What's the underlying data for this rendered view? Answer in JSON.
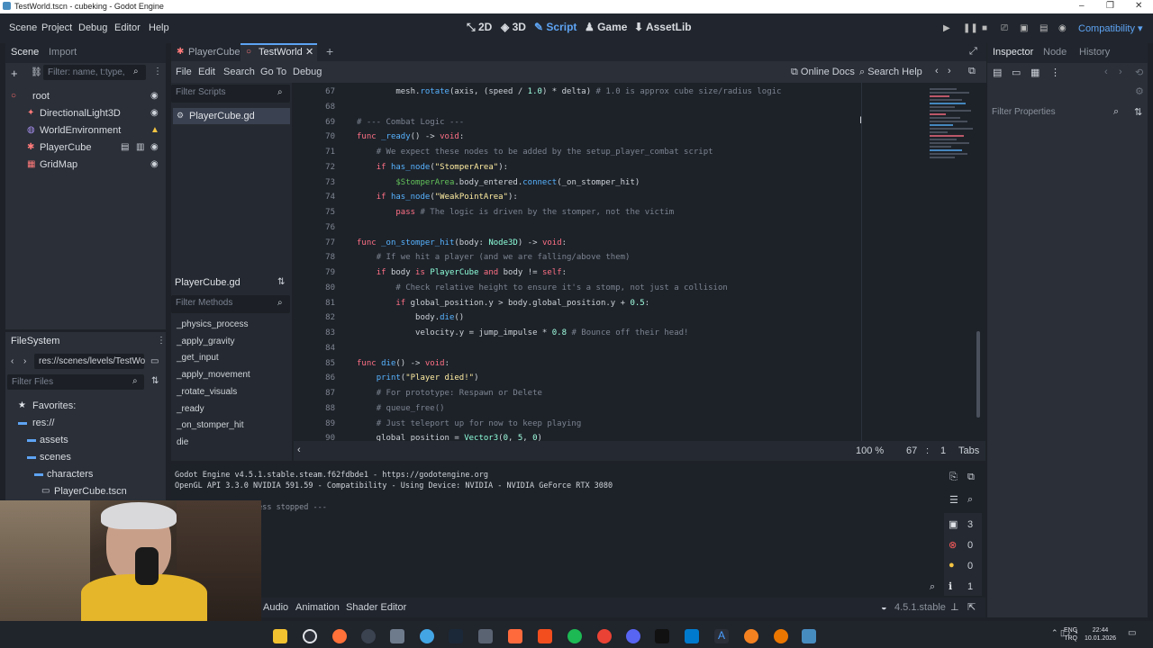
{
  "window": {
    "title": "TestWorld.tscn - cubeking - Godot Engine"
  },
  "menu": [
    "Scene",
    "Project",
    "Debug",
    "Editor",
    "Help"
  ],
  "workspaces": [
    "2D",
    "3D",
    "Script",
    "Game",
    "AssetLib"
  ],
  "renderer": "Compatibility",
  "scene_dock": {
    "tabs": [
      "Scene",
      "Import"
    ],
    "filter_placeholder": "Filter: name, t:type,",
    "nodes": [
      "root",
      "DirectionalLight3D",
      "WorldEnvironment",
      "PlayerCube",
      "GridMap"
    ]
  },
  "filesystem": {
    "title": "FileSystem",
    "path": "res://scenes/levels/TestWo",
    "filter_placeholder": "Filter Files",
    "items": [
      "Favorites:",
      "res://",
      "assets",
      "scenes",
      "characters",
      "PlayerCube.tscn"
    ]
  },
  "editor_tabs": [
    "PlayerCube",
    "TestWorld"
  ],
  "script_menu": [
    "File",
    "Edit",
    "Search",
    "Go To",
    "Debug"
  ],
  "script_tools": {
    "online_docs": "Online Docs",
    "search_help": "Search Help"
  },
  "scripts_panel": {
    "filter_placeholder": "Filter Scripts",
    "open_script": "PlayerCube.gd",
    "current_file": "PlayerCube.gd",
    "methods_placeholder": "Filter Methods",
    "methods": [
      "_physics_process",
      "_apply_gravity",
      "_get_input",
      "_apply_movement",
      "_rotate_visuals",
      "_ready",
      "_on_stomper_hit",
      "die"
    ]
  },
  "code": [
    {
      "n": "67",
      "t": "        mesh.rotate(axis, (speed / 1.0) * delta) # 1.0 is approx cube size/radius logic"
    },
    {
      "n": "68",
      "t": ""
    },
    {
      "n": "69",
      "t": "# --- Combat Logic ---"
    },
    {
      "n": "70",
      "t": "func _ready() -> void:"
    },
    {
      "n": "71",
      "t": "    # We expect these nodes to be added by the setup_player_combat script"
    },
    {
      "n": "72",
      "t": "    if has_node(\"StomperArea\"):"
    },
    {
      "n": "73",
      "t": "        $StomperArea.body_entered.connect(_on_stomper_hit)"
    },
    {
      "n": "74",
      "t": "    if has_node(\"WeakPointArea\"):"
    },
    {
      "n": "75",
      "t": "        pass # The logic is driven by the stomper, not the victim"
    },
    {
      "n": "76",
      "t": ""
    },
    {
      "n": "77",
      "t": "func _on_stomper_hit(body: Node3D) -> void:"
    },
    {
      "n": "78",
      "t": "    # If we hit a player (and we are falling/above them)"
    },
    {
      "n": "79",
      "t": "    if body is PlayerCube and body != self:"
    },
    {
      "n": "80",
      "t": "        # Check relative height to ensure it's a stomp, not just a collision"
    },
    {
      "n": "81",
      "t": "        if global_position.y > body.global_position.y + 0.5:"
    },
    {
      "n": "82",
      "t": "            body.die()"
    },
    {
      "n": "83",
      "t": "            velocity.y = jump_impulse * 0.8 # Bounce off their head!"
    },
    {
      "n": "84",
      "t": ""
    },
    {
      "n": "85",
      "t": "func die() -> void:"
    },
    {
      "n": "86",
      "t": "    print(\"Player died!\")"
    },
    {
      "n": "87",
      "t": "    # For prototype: Respawn or Delete"
    },
    {
      "n": "88",
      "t": "    # queue_free()"
    },
    {
      "n": "89",
      "t": "    # Just teleport up for now to keep playing"
    },
    {
      "n": "90",
      "t": "    global_position = Vector3(0, 5, 0)"
    }
  ],
  "status": {
    "zoom": "100 %",
    "line": "67",
    "col": "1",
    "indent": "Tabs"
  },
  "output": {
    "lines": [
      "Godot Engine v4.5.1.stable.steam.f62fdbde1 - https://godotengine.org",
      "OpenGL API 3.3.0 NVIDIA 591.59 - Compatibility - Using Device: NVIDIA - NVIDIA GeForce RTX 3080",
      "--- Debugging process stopped ---"
    ],
    "counts": {
      "messages": "3",
      "errors": "0",
      "warnings": "0",
      "info": "1"
    }
  },
  "bottom_tabs": [
    "Audio",
    "Animation",
    "Shader Editor"
  ],
  "version": "4.5.1.stable",
  "inspector": {
    "tabs": [
      "Inspector",
      "Node",
      "History"
    ],
    "filter_placeholder": "Filter Properties"
  },
  "taskbar": {
    "lang_top": "ENG",
    "lang_bottom": "TRQ",
    "time": "22:44",
    "date": "10.01.2026"
  },
  "colors": {
    "accent": "#5ea3f3",
    "bg": "#1e2228",
    "panel": "#2a2f38"
  }
}
